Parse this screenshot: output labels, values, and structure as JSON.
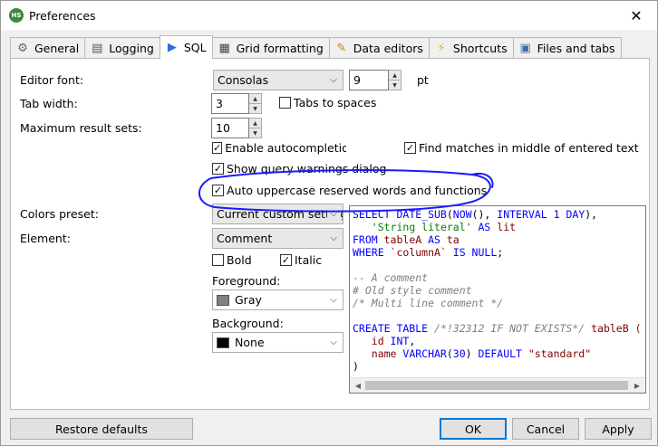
{
  "window": {
    "title": "Preferences",
    "app_icon_text": "HS",
    "close_glyph": "✕"
  },
  "tabs": [
    {
      "label": "General",
      "icon": "gear-icon",
      "glyph": "⚙",
      "color": "#666666"
    },
    {
      "label": "Logging",
      "icon": "log-icon",
      "glyph": "▤",
      "color": "#555555"
    },
    {
      "label": "SQL",
      "icon": "sql-arrow-icon",
      "glyph": "▶",
      "color": "#2b6fd6"
    },
    {
      "label": "Grid formatting",
      "icon": "grid-icon",
      "glyph": "▦",
      "color": "#444444"
    },
    {
      "label": "Data editors",
      "icon": "data-editor-icon",
      "glyph": "✎",
      "color": "#c08a20"
    },
    {
      "label": "Shortcuts",
      "icon": "lightning-icon",
      "glyph": "⚡",
      "color": "#f0b400"
    },
    {
      "label": "Files and tabs",
      "icon": "files-icon",
      "glyph": "▣",
      "color": "#3a6ea5"
    }
  ],
  "active_tab": "SQL",
  "sql": {
    "editor_font_label": "Editor font:",
    "editor_font_value": "Consolas",
    "font_size_value": "9",
    "font_size_unit": "pt",
    "tab_width_label": "Tab width:",
    "tab_width_value": "3",
    "tabs_to_spaces_label": "Tabs to spaces",
    "tabs_to_spaces_checked": false,
    "max_result_sets_label": "Maximum result sets:",
    "max_result_sets_value": "10",
    "enable_autocompletion_label": "Enable autocompletion",
    "enable_autocompletion_checked": true,
    "find_matches_label": "Find matches in middle of entered text",
    "find_matches_checked": true,
    "show_query_warnings_label": "Show query warnings dialog",
    "show_query_warnings_checked": true,
    "auto_uppercase_label": "Auto uppercase reserved words and functions",
    "auto_uppercase_checked": true,
    "colors_preset_label": "Colors preset:",
    "colors_preset_value": "Current custom setting",
    "element_label": "Element:",
    "element_value": "Comment",
    "bold_label": "Bold",
    "bold_checked": false,
    "italic_label": "Italic",
    "italic_checked": true,
    "foreground_label": "Foreground:",
    "foreground_value": "Gray",
    "foreground_color": "#808080",
    "background_label": "Background:",
    "background_value": "None",
    "background_color": "#000000"
  },
  "preview_code": [
    [
      {
        "t": "SELECT ",
        "c": "kw"
      },
      {
        "t": "DATE_SUB",
        "c": "kw"
      },
      {
        "t": "(",
        "c": ""
      },
      {
        "t": "NOW",
        "c": "kw"
      },
      {
        "t": "(), ",
        "c": ""
      },
      {
        "t": "INTERVAL ",
        "c": "kw"
      },
      {
        "t": "1",
        "c": "num"
      },
      {
        "t": " ",
        "c": ""
      },
      {
        "t": "DAY",
        "c": "kw"
      },
      {
        "t": "),",
        "c": ""
      }
    ],
    [
      {
        "t": "   ",
        "c": ""
      },
      {
        "t": "'String literal'",
        "c": "str"
      },
      {
        "t": " ",
        "c": ""
      },
      {
        "t": "AS",
        "c": "kw"
      },
      {
        "t": " lit",
        "c": "id"
      }
    ],
    [
      {
        "t": "FROM ",
        "c": "kw"
      },
      {
        "t": "tableA ",
        "c": "id"
      },
      {
        "t": "AS ",
        "c": "kw"
      },
      {
        "t": "ta",
        "c": "id"
      }
    ],
    [
      {
        "t": "WHERE ",
        "c": "kw"
      },
      {
        "t": "`columnA`",
        "c": "id"
      },
      {
        "t": " IS NULL",
        "c": "kw"
      },
      {
        "t": ";",
        "c": ""
      }
    ],
    [
      {
        "t": "",
        "c": ""
      }
    ],
    [
      {
        "t": "-- A comment",
        "c": "cm"
      }
    ],
    [
      {
        "t": "# Old style comment",
        "c": "cm"
      }
    ],
    [
      {
        "t": "/* Multi line comment */",
        "c": "cm"
      }
    ],
    [
      {
        "t": "",
        "c": ""
      }
    ],
    [
      {
        "t": "CREATE TABLE ",
        "c": "kw"
      },
      {
        "t": "/*!32312 IF NOT EXISTS*/",
        "c": "cm"
      },
      {
        "t": " tableB (",
        "c": "id"
      }
    ],
    [
      {
        "t": "   id ",
        "c": "id"
      },
      {
        "t": "INT",
        "c": "kw"
      },
      {
        "t": ",",
        "c": ""
      }
    ],
    [
      {
        "t": "   name ",
        "c": "id"
      },
      {
        "t": "VARCHAR",
        "c": "kw"
      },
      {
        "t": "(",
        "c": ""
      },
      {
        "t": "30",
        "c": "num"
      },
      {
        "t": ") ",
        "c": ""
      },
      {
        "t": "DEFAULT ",
        "c": "kw"
      },
      {
        "t": "\"standard\"",
        "c": "id"
      }
    ],
    [
      {
        "t": ")",
        "c": ""
      }
    ]
  ],
  "buttons": {
    "restore_defaults": "Restore defaults",
    "ok": "OK",
    "cancel": "Cancel",
    "apply": "Apply"
  },
  "annotation_color": "#1a1aff"
}
